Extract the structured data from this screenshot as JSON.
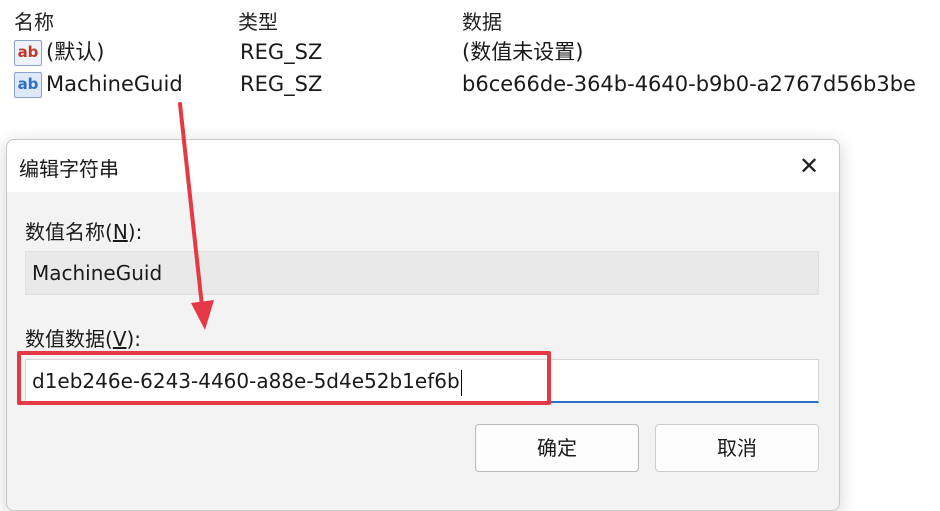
{
  "columns": {
    "name": "名称",
    "type": "类型",
    "data": "数据"
  },
  "rows": [
    {
      "icon": "string-value-icon",
      "name": "(默认)",
      "type": "REG_SZ",
      "data": "(数值未设置)"
    },
    {
      "icon": "string-value-icon",
      "name": "MachineGuid",
      "type": "REG_SZ",
      "data": "b6ce66de-364b-4640-b9b0-a2767d56b3be"
    }
  ],
  "icon_text": "ab",
  "dialog": {
    "title": "编辑字符串",
    "close_symbol": "✕",
    "value_name_label_prefix": "数值名称(",
    "value_name_label_key": "N",
    "value_name_label_suffix": "):",
    "value_name": "MachineGuid",
    "value_data_label_prefix": "数值数据(",
    "value_data_label_key": "V",
    "value_data_label_suffix": "):",
    "value_data": "d1eb246e-6243-4460-a88e-5d4e52b1ef6b",
    "ok_label": "确定",
    "cancel_label": "取消"
  },
  "colors": {
    "highlight": "#e53946",
    "accent": "#2b6fc9",
    "arrow": "#e53946"
  }
}
